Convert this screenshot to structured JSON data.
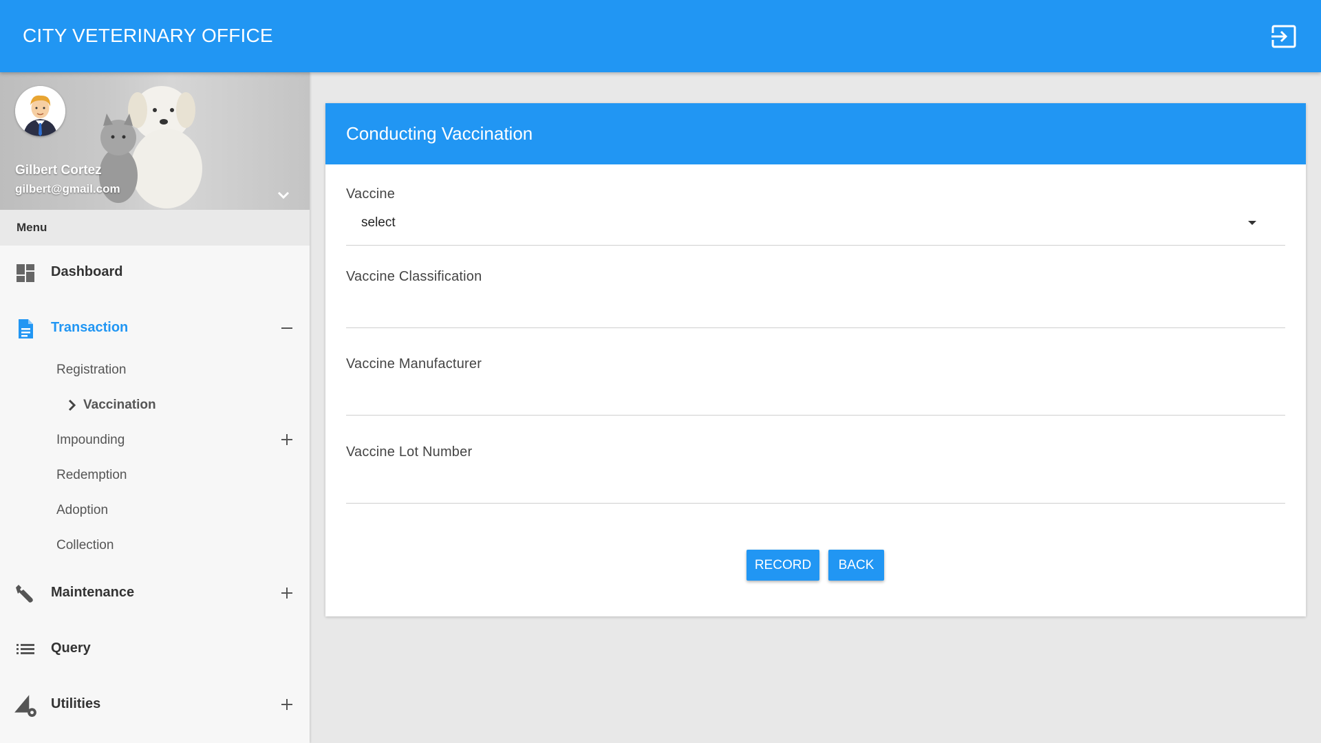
{
  "app": {
    "title": "CITY VETERINARY OFFICE",
    "logout_icon": "exit-to-app-icon"
  },
  "profile": {
    "name": "Gilbert Cortez",
    "email": "gilbert@gmail.com"
  },
  "sidebar": {
    "menu_header": "Menu",
    "items": [
      {
        "label": "Dashboard",
        "icon": "dashboard-icon"
      },
      {
        "label": "Transaction",
        "icon": "document-icon",
        "expanded": true,
        "children": [
          {
            "label": "Registration"
          },
          {
            "label": "Vaccination",
            "current": true
          },
          {
            "label": "Impounding",
            "expandable": true
          },
          {
            "label": "Redemption"
          },
          {
            "label": "Adoption"
          },
          {
            "label": "Collection"
          }
        ]
      },
      {
        "label": "Maintenance",
        "icon": "wrench-icon",
        "expandable": true
      },
      {
        "label": "Query",
        "icon": "list-icon"
      },
      {
        "label": "Utilities",
        "icon": "utilities-icon",
        "expandable": true
      }
    ]
  },
  "form": {
    "title": "Conducting Vaccination",
    "fields": {
      "vaccine": {
        "label": "Vaccine",
        "value": "select"
      },
      "classification": {
        "label": "Vaccine Classification",
        "value": ""
      },
      "manufacturer": {
        "label": "Vaccine Manufacturer",
        "value": ""
      },
      "lot_number": {
        "label": "Vaccine Lot Number",
        "value": ""
      }
    },
    "buttons": {
      "record": "RECORD",
      "back": "BACK"
    }
  },
  "colors": {
    "primary": "#2196f3",
    "sidebar_bg": "#f7f7f7",
    "page_bg": "#e8e8e8"
  }
}
